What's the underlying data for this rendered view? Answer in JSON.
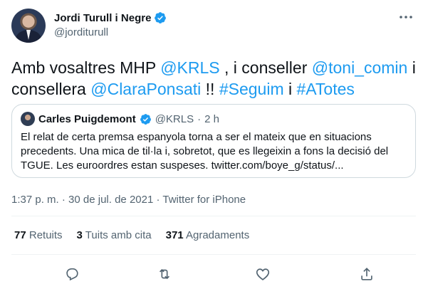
{
  "header": {
    "display_name": "Jordi Turull i Negre",
    "handle": "@jorditurull",
    "verified_icon": "verified-badge-icon",
    "more_icon": "more-icon",
    "accent": "#1d9bf0"
  },
  "tweet": {
    "t1": "Amb vosaltres  MHP ",
    "m1": "@KRLS",
    "t2": " , i conseller ",
    "m2": "@toni_comin",
    "t3": " i consellera ",
    "m3": "@ClaraPonsati",
    "t4": " !! ",
    "h1": "#Seguim",
    "t5": " i ",
    "h2": "#ATotes"
  },
  "quote": {
    "name": "Carles Puigdemont",
    "handle": "@KRLS",
    "sep": "·",
    "time": "2 h",
    "text": "El relat de certa premsa espanyola torna a ser el mateix que en situacions precedents. Una mica de til·la i, sobretot, que es llegeixin a fons la decisió del TGUE. Les euroordres estan suspeses. twitter.com/boye_g/status/..."
  },
  "meta": {
    "time": "1:37 p. m.",
    "sep1": " · ",
    "date": "30 de jul. de 2021",
    "sep2": " · ",
    "source": "Twitter for iPhone"
  },
  "stats": {
    "retweets_count": "77",
    "retweets_label": "Retuits",
    "quotes_count": "3",
    "quotes_label": "Tuits amb cita",
    "likes_count": "371",
    "likes_label": "Agradaments"
  },
  "actions": [
    "reply-icon",
    "retweet-icon",
    "like-icon",
    "share-icon"
  ]
}
